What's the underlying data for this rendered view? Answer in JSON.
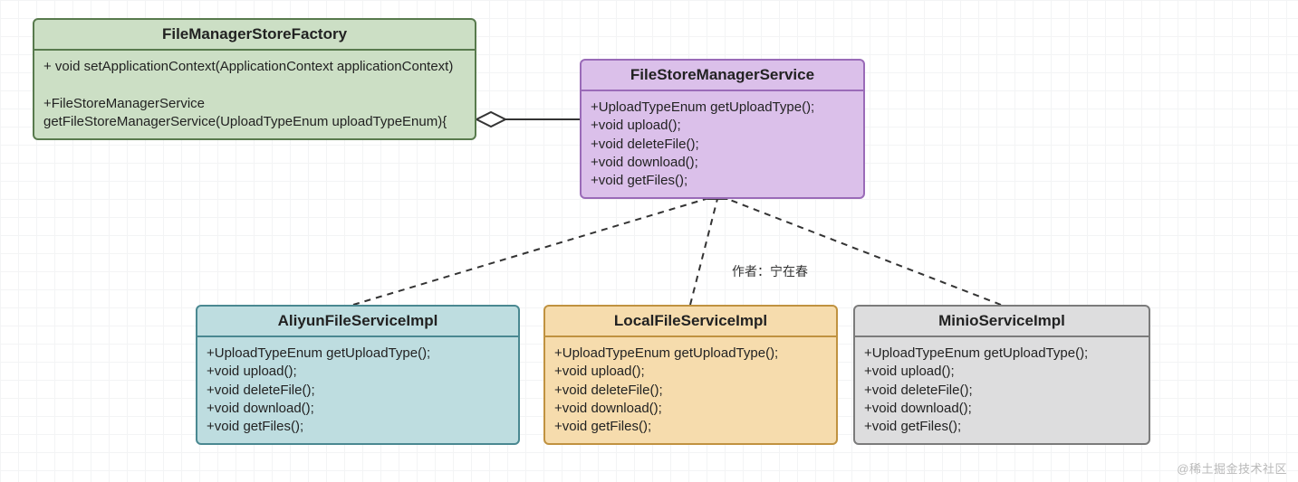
{
  "classes": {
    "factory": {
      "name": "FileManagerStoreFactory",
      "members": "+ void setApplicationContext(ApplicationContext applicationContext)\n\n+FileStoreManagerService getFileStoreManagerService(UploadTypeEnum uploadTypeEnum){"
    },
    "service": {
      "name": "FileStoreManagerService",
      "members": "+UploadTypeEnum getUploadType();\n+void upload();\n+void deleteFile();\n+void download();\n+void getFiles();"
    },
    "aliyun": {
      "name": "AliyunFileServiceImpl",
      "members": "+UploadTypeEnum getUploadType();\n+void upload();\n+void deleteFile();\n+void download();\n+void getFiles();"
    },
    "local": {
      "name": "LocalFileServiceImpl",
      "members": "+UploadTypeEnum getUploadType();\n+void upload();\n+void deleteFile();\n+void download();\n+void getFiles();"
    },
    "minio": {
      "name": "MinioServiceImpl",
      "members": "+UploadTypeEnum getUploadType();\n+void upload();\n+void deleteFile();\n+void download();\n+void getFiles();"
    }
  },
  "annotations": {
    "author": "作者：宁在春",
    "watermark": "@稀土掘金技术社区"
  },
  "relationships": [
    {
      "from": "factory",
      "to": "service",
      "kind": "aggregation"
    },
    {
      "from": "aliyun",
      "to": "service",
      "kind": "realization"
    },
    {
      "from": "local",
      "to": "service",
      "kind": "realization"
    },
    {
      "from": "minio",
      "to": "service",
      "kind": "realization"
    }
  ]
}
